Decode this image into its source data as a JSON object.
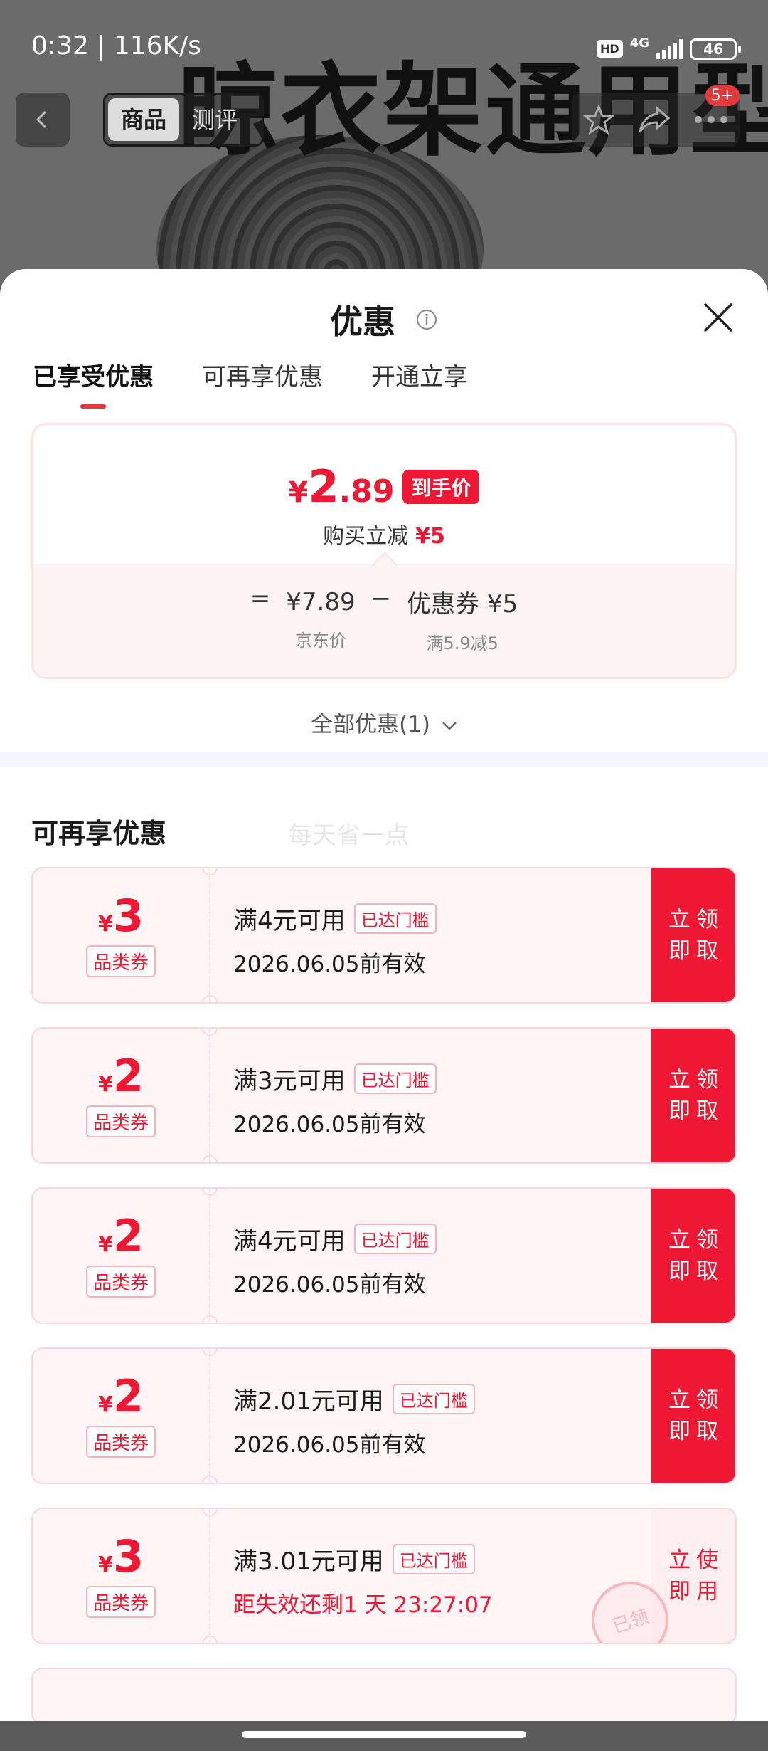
{
  "status_bar": {
    "time_speed": "0:32 | 116K/s",
    "hd": "HD",
    "network": "4G",
    "battery": "46"
  },
  "background": {
    "banner_text": "晾衣架通用型",
    "tabs": [
      "商品",
      "测评"
    ],
    "badge": "5+"
  },
  "sheet": {
    "title": "优惠",
    "tabs": [
      {
        "label": "已享受优惠",
        "active": true
      },
      {
        "label": "可再享优惠",
        "active": false
      },
      {
        "label": "开通立享",
        "active": false
      }
    ],
    "price_card": {
      "currency": "¥",
      "final_int": "2",
      "final_dec": ".89",
      "final_tag": "到手价",
      "reduce_label": "购买立减",
      "reduce_value": "¥5",
      "eq": "=",
      "minus": "−",
      "jd_price": "¥7.89",
      "jd_price_label": "京东价",
      "coupon_part": "优惠券 ¥5",
      "coupon_part_label": "满5.9减5"
    },
    "all_discounts": "全部优惠(1)",
    "section_title": "可再享优惠",
    "section_watermark": "每天省一点",
    "coupons": [
      {
        "currency": "¥",
        "amount": "3",
        "type": "品类券",
        "condition": "满4元可用",
        "met": "已达门槛",
        "validity": "2026.06.05前有效",
        "button": "立即领取",
        "button_l1": "立即",
        "button_l2": "领取"
      },
      {
        "currency": "¥",
        "amount": "2",
        "type": "品类券",
        "condition": "满3元可用",
        "met": "已达门槛",
        "validity": "2026.06.05前有效",
        "button": "立即领取",
        "button_l1": "立即",
        "button_l2": "领取"
      },
      {
        "currency": "¥",
        "amount": "2",
        "type": "品类券",
        "condition": "满4元可用",
        "met": "已达门槛",
        "validity": "2026.06.05前有效",
        "button": "立即领取",
        "button_l1": "立即",
        "button_l2": "领取"
      },
      {
        "currency": "¥",
        "amount": "2",
        "type": "品类券",
        "condition": "满2.01元可用",
        "met": "已达门槛",
        "validity": "2026.06.05前有效",
        "button": "立即领取",
        "button_l1": "立即",
        "button_l2": "领取"
      },
      {
        "currency": "¥",
        "amount": "3",
        "type": "品类券",
        "condition": "满3.01元可用",
        "met": "已达门槛",
        "validity": "距失效还剩1 天 23:27:07",
        "button": "立即使用",
        "button_l1": "立即",
        "button_l2": "使用",
        "stamp": "已领"
      }
    ]
  },
  "colors": {
    "accent": "#ee1834",
    "coupon_bg": "#fff5f6",
    "coupon_border": "#fbd7dc"
  }
}
